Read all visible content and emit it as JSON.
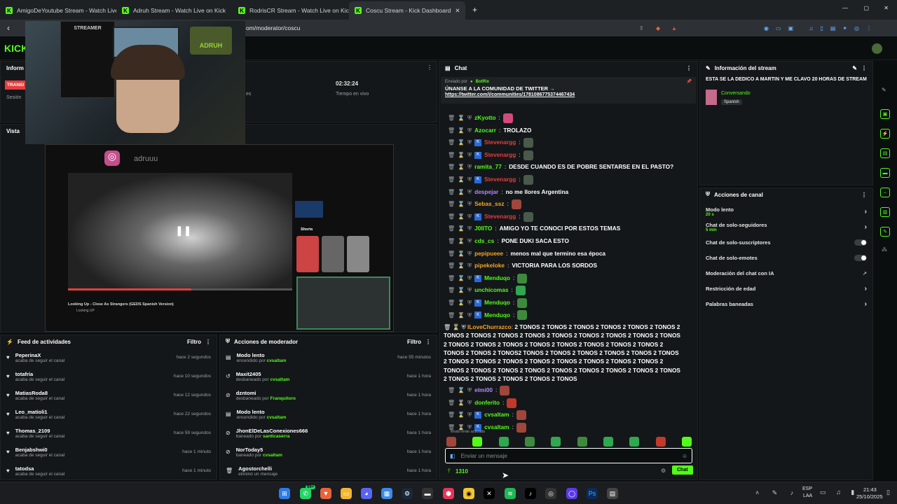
{
  "browser": {
    "tabs": [
      {
        "label": "AmigoDeYoutube Stream - Watch Live"
      },
      {
        "label": "Adruh Stream - Watch Live on Kick"
      },
      {
        "label": "RodrisCR Stream - Watch Live on Kick"
      },
      {
        "label": "Coscu Stream - Kick Dashboard"
      }
    ],
    "url": "om/moderator/coscu"
  },
  "webcam": {
    "cap": "STREAMER",
    "sign": "ADRUH"
  },
  "overlay": {
    "instagram_handle": "adruuu"
  },
  "left": {
    "info_title": "Inform",
    "tag": "TRANSI",
    "session": "Sesión",
    "vista_title": "Vista",
    "timer": "02:32:24",
    "timer_label": "Tiempo en vivo",
    "es": "es"
  },
  "video_preview": {
    "title": "Looking Up - Close As Strangers (GEDS Spanish Version)",
    "channel": "Looking UP",
    "shorts": "Shorts",
    "search_hint": "Presionar"
  },
  "feed": {
    "title": "Feed de actividades",
    "filter": "Filtro",
    "items": [
      {
        "name": "PeperinaX",
        "sub": "acaba de seguir el canal",
        "time": "hace 2 segundos"
      },
      {
        "name": "totafría",
        "sub": "acaba de seguir el canal",
        "time": "hace 10 segundos"
      },
      {
        "name": "MatiasRoda8",
        "sub": "acaba de seguir el canal",
        "time": "hace 12 segundos"
      },
      {
        "name": "Leo_matioli1",
        "sub": "acaba de seguir el canal",
        "time": "hace 22 segundos"
      },
      {
        "name": "Thomas_2109",
        "sub": "acaba de seguir el canal",
        "time": "hace 59 segundos"
      },
      {
        "name": "Benjabshwi0",
        "sub": "acaba de seguir el canal",
        "time": "hace 1 minuto"
      },
      {
        "name": "tatodsa",
        "sub": "acaba de seguir el canal",
        "time": "hace 1 minuto"
      }
    ]
  },
  "mod": {
    "title": "Acciones de moderador",
    "filter": "Filtro",
    "items": [
      {
        "name": "Modo lento",
        "sub": "encendido por",
        "by": "cvsaltam",
        "time": "hace 55 minutos"
      },
      {
        "name": "Maxit2405",
        "sub": "desbaneado por",
        "by": "cvsaltam",
        "time": "hace 1 hora"
      },
      {
        "name": "dzntomi",
        "sub": "desbaneado por",
        "by": "Franquitoro",
        "time": "hace 1 hora"
      },
      {
        "name": "Modo lento",
        "sub": "encendido por",
        "by": "cvsaltam",
        "time": "hace 1 hora"
      },
      {
        "name": "JhonElDeLasConexiones666",
        "sub": "baneado por",
        "by": "santicaserra",
        "time": "hace 1 hora"
      },
      {
        "name": "NorToday5",
        "sub": "baneado por",
        "by": "cvsaltam",
        "time": "hace 1 hora"
      },
      {
        "name": "Agostorchelli",
        "sub": "eliminó un mensaje",
        "by": "",
        "time": "hace 1 hora"
      }
    ]
  },
  "chat": {
    "title": "Chat",
    "pinned_by": "Enviado por",
    "pinned_user": "BotRix",
    "pinned_text": "ÚNANSE A LA COMUNIDAD DE TWITTER →",
    "pinned_link": "https://twitter.com/i/communities/1781086775374467434",
    "slow_mode": "Modo lento activado",
    "input_placeholder": "Enviar un mensaje",
    "points": "1310",
    "send": "Chat",
    "messages": [
      {
        "user": "zKyotto",
        "color": "#53fc18",
        "text": "",
        "emote": "#d24a7a"
      },
      {
        "user": "Azocarr",
        "color": "#53fc18",
        "text": "TROLAZO"
      },
      {
        "user": "Stevenargg",
        "color": "#e53e3e",
        "text": "",
        "emote": "#4a5a4a",
        "badge": true
      },
      {
        "user": "Stevenargg",
        "color": "#e53e3e",
        "text": "",
        "emote": "#4a5a4a",
        "badge": true
      },
      {
        "user": "ramita_77",
        "color": "#53fc18",
        "text": "DESDE CUANDO ES DE POBRE SENTARSE EN EL PASTO?"
      },
      {
        "user": "Stevenargg",
        "color": "#e53e3e",
        "text": "",
        "emote": "#4a5a4a",
        "badge": true
      },
      {
        "user": "despejar",
        "color": "#b388ff",
        "text": "no me llores Argentina"
      },
      {
        "user": "Sebas_ssz",
        "color": "#f5a623",
        "text": "",
        "emote": "#a0463a"
      },
      {
        "user": "Stevenargg",
        "color": "#e53e3e",
        "text": "",
        "emote": "#4a5a4a",
        "badge": true
      },
      {
        "user": "J0IITO",
        "color": "#53fc18",
        "text": "AMIGO YO TE CONOCI POR ESTOS TEMAS"
      },
      {
        "user": "cds_cs",
        "color": "#53fc18",
        "text": "PONE DUKI SACA ESTO"
      },
      {
        "user": "pepipueee",
        "color": "#f5a623",
        "text": "menos mal que termino esa época"
      },
      {
        "user": "pipekeloke",
        "color": "#f5a623",
        "text": "VICTORIA PARA LOS SORDOS"
      },
      {
        "user": "Menduqo",
        "color": "#53fc18",
        "text": "",
        "emote": "#3d8a3d",
        "badge": true
      },
      {
        "user": "unchicomas",
        "color": "#53fc18",
        "text": "",
        "emote": "#2fa84f"
      },
      {
        "user": "Menduqo",
        "color": "#53fc18",
        "text": "",
        "emote": "#3d8a3d",
        "badge": true
      },
      {
        "user": "Menduqo",
        "color": "#53fc18",
        "text": "",
        "emote": "#3d8a3d",
        "badge": true
      }
    ],
    "long_msg": {
      "user": "ILoveChurrazco",
      "color": "#f5a623",
      "text": "2 TONOS 2 TONOS 2 TONOS 2 TONOS 2 TONOS 2 TONOS 2 TONOS 2 TONOS 2 TONOS 2 TONOS 2 TONOS 2 TONOS 2 TONOS 2 TONOS 2 TONOS 2 TONOS 2 TONOS 2 TONOS 2 TONOS 2 TONOS 2 TONOS 2 TONOS 2 TONOS 2 TONOS 2 TONOS 2 TONOS2 TONOS 2 TONOS 2 TONOS 2 TONOS 2 TONOS 2 TONOS 2 TONOS 2 TONOS 2 TONOS 2 TONOS 2 TONOS 2 TONOS 2 TONOS 2 TONOS 2 TONOS 2 TONOS 2 TONOS 2 TONOS 2 TONOS 2 TONOS 2 TONOS 2 TONOS 2 TONOS 2 TONOS 2 TONOS 2 TONOS 2 TONOS 2 TONOS"
    },
    "tail": [
      {
        "user": "elmi00",
        "color": "#b388ff",
        "emote": "#a0463a"
      },
      {
        "user": "donferito",
        "color": "#53fc18",
        "emote": "#c0392b"
      },
      {
        "user": "cvsaltam",
        "color": "#53fc18",
        "emote": "#a0463a",
        "badge": true
      },
      {
        "user": "cvsaltam",
        "color": "#53fc18",
        "emote": "#a0463a",
        "badge": true
      }
    ]
  },
  "stream_info": {
    "title": "Información del stream",
    "stream_title": "ESTA SE LA DEDICO A MARTIN Y ME CLAVO 20 HORAS DE STREAM",
    "category": "Conversando",
    "language": "Spanish"
  },
  "channel_actions": {
    "title": "Acciones de canal",
    "items": [
      {
        "label": "Modo lento",
        "sub": "20 s",
        "kind": "arrow"
      },
      {
        "label": "Chat de solo-seguidores",
        "sub": "5 min",
        "kind": "arrow"
      },
      {
        "label": "Chat de solo-suscriptores",
        "sub": "",
        "kind": "toggle"
      },
      {
        "label": "Chat de solo-emotes",
        "sub": "",
        "kind": "toggle"
      },
      {
        "label": "Moderación del chat con IA",
        "sub": "",
        "kind": "link"
      },
      {
        "label": "Restricción de edad",
        "sub": "",
        "kind": "arrow"
      },
      {
        "label": "Palabras baneadas",
        "sub": "",
        "kind": "arrow"
      }
    ]
  },
  "taskbar": {
    "lang": "ESP",
    "layout": "LAA",
    "time": "21:43",
    "date": "25/10/2025",
    "badge": "99+"
  }
}
